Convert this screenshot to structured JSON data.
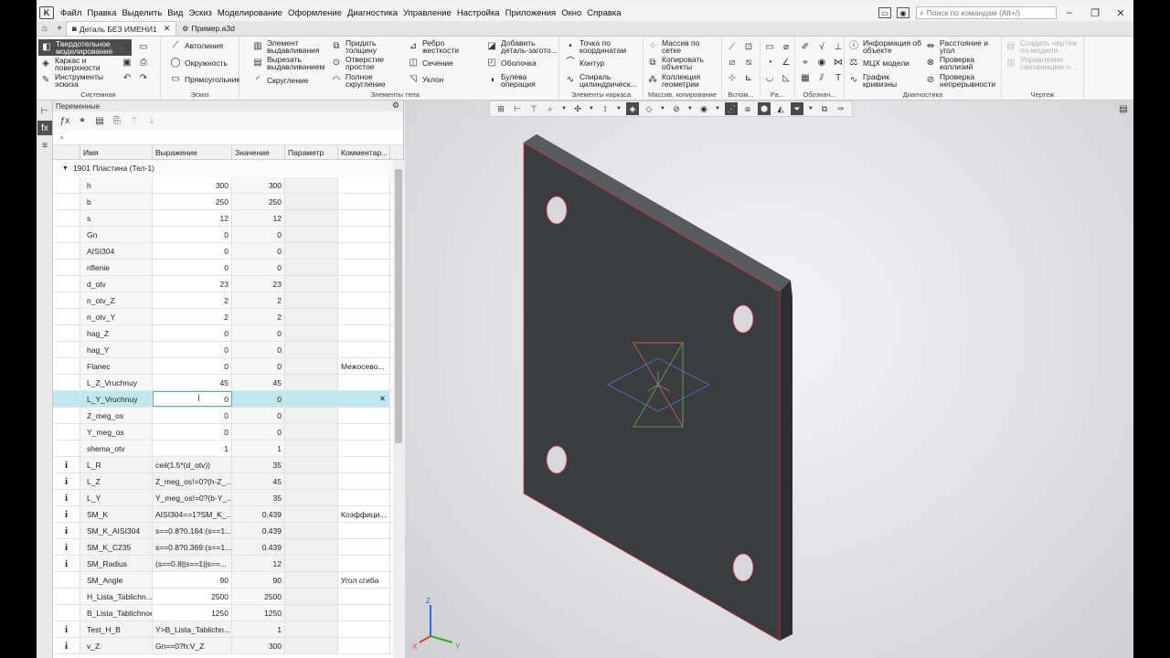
{
  "menu": {
    "items": [
      "Файл",
      "Правка",
      "Выделить",
      "Вид",
      "Эскиз",
      "Моделирование",
      "Оформление",
      "Диагностика",
      "Управление",
      "Настройка",
      "Приложения",
      "Окно",
      "Справка"
    ],
    "search_placeholder": "Поиск по командам (Alt+/)"
  },
  "tabs": [
    {
      "label": "Деталь БЕЗ ИМЕНИ1",
      "active": true
    },
    {
      "label": "Пример.a3d",
      "active": false
    }
  ],
  "ribbon": {
    "system_buttons": [
      "Твердотельное моделирование",
      "Каркас и поверхности",
      "Инструменты эскиза"
    ],
    "system_label": "Системная",
    "sketch_buttons": [
      "Автолиния",
      "Окружность",
      "Прямоугольник"
    ],
    "sketch_label": "Эскиз",
    "body_col1": [
      "Элемент выдавливания",
      "Вырезать выдавливанием",
      "Скругление"
    ],
    "body_col2": [
      "Придать толщину",
      "Отверстие простое",
      "Полное скругление"
    ],
    "body_col3": [
      "Ребро жесткости",
      "Сечение",
      "Уклон"
    ],
    "body_label": "Элементы тела",
    "frame_col1": [
      "Добавить деталь-загото...",
      "Оболочка",
      "Булева операция"
    ],
    "frame_col2": [
      "Точка по координатам",
      "Контур",
      "Спираль цилиндрическ..."
    ],
    "frame_label": "Элементы каркаса",
    "array_buttons": [
      "Массив по сетке",
      "Копировать объекты",
      "Коллекция геометрии"
    ],
    "array_label": "Массив, копирование",
    "aux_label": "Вспом...",
    "sizes_label": "Ра...",
    "notation_label": "Обознач...",
    "diag_col1": [
      "Информация об объекте",
      "МЦХ модели",
      "График кривизны"
    ],
    "diag_col2": [
      "Расстояние и угол",
      "Проверка коллизий",
      "Проверка непрерывности"
    ],
    "diag_label": "Диагностика",
    "drawing_buttons": [
      "Создать чертеж по модели",
      "Управление связанными ч..."
    ],
    "drawing_label": "Чертеж"
  },
  "panel": {
    "title": "Переменные",
    "columns": [
      "Имя",
      "Выражение",
      "Значение",
      "Параметр",
      "Комментар..."
    ],
    "group": "1901 Пластина  (Тел-1)"
  },
  "variables": [
    {
      "calc": false,
      "name": "h",
      "expr": "300",
      "value": "300",
      "comment": ""
    },
    {
      "calc": false,
      "name": "b",
      "expr": "250",
      "value": "250",
      "comment": ""
    },
    {
      "calc": false,
      "name": "s",
      "expr": "12",
      "value": "12",
      "comment": ""
    },
    {
      "calc": false,
      "name": "Gn",
      "expr": "0",
      "value": "0",
      "comment": ""
    },
    {
      "calc": false,
      "name": "AISI304",
      "expr": "0",
      "value": "0",
      "comment": ""
    },
    {
      "calc": false,
      "name": "riflenie",
      "expr": "0",
      "value": "0",
      "comment": ""
    },
    {
      "calc": false,
      "name": "d_otv",
      "expr": "23",
      "value": "23",
      "comment": ""
    },
    {
      "calc": false,
      "name": "n_otv_Z",
      "expr": "2",
      "value": "2",
      "comment": ""
    },
    {
      "calc": false,
      "name": "n_otv_Y",
      "expr": "2",
      "value": "2",
      "comment": ""
    },
    {
      "calc": false,
      "name": "hag_Z",
      "expr": "0",
      "value": "0",
      "comment": ""
    },
    {
      "calc": false,
      "name": "hag_Y",
      "expr": "0",
      "value": "0",
      "comment": ""
    },
    {
      "calc": false,
      "name": "Flanec",
      "expr": "0",
      "value": "0",
      "comment": "Межосево..."
    },
    {
      "calc": false,
      "name": "L_Z_Vruchnuy",
      "expr": "45",
      "value": "45",
      "comment": ""
    },
    {
      "calc": false,
      "name": "L_Y_Vruchnuy",
      "expr": "0",
      "value": "0",
      "comment": "",
      "selected": true
    },
    {
      "calc": false,
      "name": "Z_meg_os",
      "expr": "0",
      "value": "0",
      "comment": ""
    },
    {
      "calc": false,
      "name": "Y_meg_os",
      "expr": "0",
      "value": "0",
      "comment": ""
    },
    {
      "calc": false,
      "name": "shema_otv",
      "expr": "1",
      "value": "1",
      "comment": ""
    },
    {
      "calc": true,
      "name": "L_R",
      "expr": "ceil(1.5*(d_otv))",
      "value": "35",
      "comment": ""
    },
    {
      "calc": true,
      "name": "L_Z",
      "expr": "Z_meg_os!=0?(h-Z_...",
      "value": "45",
      "comment": ""
    },
    {
      "calc": true,
      "name": "L_Y",
      "expr": "Y_meg_os!=0?(b-Y_...",
      "value": "35",
      "comment": ""
    },
    {
      "calc": true,
      "name": "SM_K",
      "expr": "AISI304==1?SM_K_...",
      "value": "0.439",
      "comment": "Коэффици..."
    },
    {
      "calc": true,
      "name": "SM_K_AISI304",
      "expr": "s==0.8?0.184:(s==1...",
      "value": "0.439",
      "comment": ""
    },
    {
      "calc": true,
      "name": "SM_K_C235",
      "expr": "s==0.8?0.369:(s==1...",
      "value": "0.439",
      "comment": ""
    },
    {
      "calc": true,
      "name": "SM_Radius",
      "expr": "(s==0.8||s==1||s==...",
      "value": "12",
      "comment": ""
    },
    {
      "calc": false,
      "name": "SM_Angle",
      "expr": "90",
      "value": "90",
      "comment": "Угол сгиба"
    },
    {
      "calc": false,
      "name": "H_Lista_Tablichn...",
      "expr": "2500",
      "value": "2500",
      "comment": ""
    },
    {
      "calc": false,
      "name": "B_Lista_Tablichnoe",
      "expr": "1250",
      "value": "1250",
      "comment": ""
    },
    {
      "calc": true,
      "name": "Test_H_B",
      "expr": "Y>B_Lista_Tablichn...",
      "value": "1",
      "comment": ""
    },
    {
      "calc": true,
      "name": "v_Z",
      "expr": "Gn==0?h:V_Z",
      "value": "300",
      "comment": ""
    }
  ],
  "colors": {
    "plate_face": "#3b3c3f",
    "plate_edge": "#d2344a",
    "selection_row": "#bfe8ee",
    "axis_x": "#e04040",
    "axis_y": "#3aa03a",
    "axis_z": "#3a6ad0"
  },
  "axis_labels": {
    "x": "X",
    "y": "Y",
    "z": "Z"
  },
  "icons": {
    "calc_marker": "i"
  }
}
